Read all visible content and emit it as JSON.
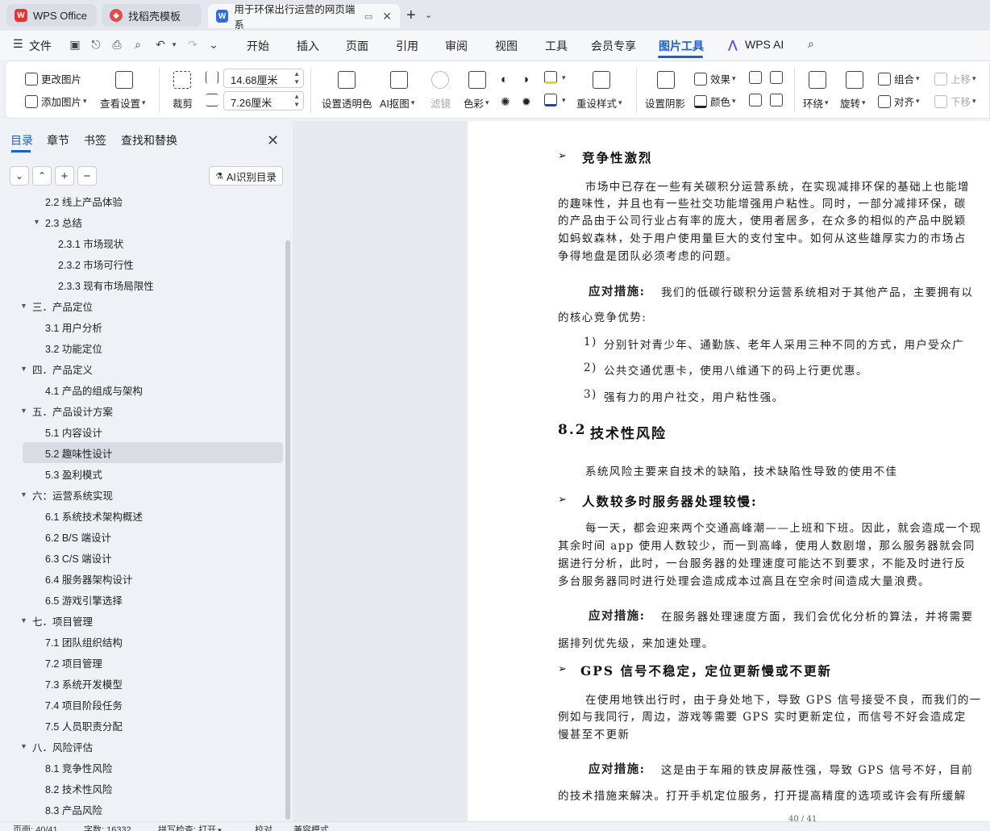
{
  "tabs": [
    {
      "label": "WPS Office",
      "icon": "wps-logo-icon"
    },
    {
      "label": "找稻壳模板",
      "icon": "docer-icon"
    },
    {
      "label": "用于环保出行运营的网页端系",
      "icon": "writer-doc-icon"
    }
  ],
  "menu": {
    "file": "文件",
    "items": [
      "开始",
      "插入",
      "页面",
      "引用",
      "审阅",
      "视图",
      "工具",
      "会员专享",
      "图片工具",
      "WPS AI"
    ]
  },
  "ribbon": {
    "change_image": "更改图片",
    "add_image": "添加图片",
    "view_settings": "查看设置",
    "crop": "裁剪",
    "width_value": "14.68厘米",
    "height_value": "7.26厘米",
    "set_transparent": "设置透明色",
    "ai_cutout": "AI抠图",
    "filter": "滤镜",
    "color": "色彩",
    "reset_style": "重设样式",
    "set_shadow": "设置阴影",
    "effects": "效果",
    "shade": "颜色",
    "wrap": "环绕",
    "rotate": "旋转",
    "group": "组合",
    "align": "对齐",
    "bring_forward": "上移",
    "send_backward": "下移"
  },
  "nav": {
    "tabs": [
      "目录",
      "章节",
      "书签",
      "查找和替换"
    ],
    "ai_toc": "AI识别目录",
    "toc": [
      {
        "label": "2.2  线上产品体验",
        "level": 2,
        "expand": ""
      },
      {
        "label": "2.3  总结",
        "level": 2,
        "expand": "▼"
      },
      {
        "label": "2.3.1  市场现状",
        "level": 3,
        "expand": ""
      },
      {
        "label": "2.3.2  市场可行性",
        "level": 3,
        "expand": ""
      },
      {
        "label": "2.3.3  现有市场局限性",
        "level": 3,
        "expand": ""
      },
      {
        "label": "三．产品定位",
        "level": 1,
        "expand": "▼"
      },
      {
        "label": "3.1  用户分析",
        "level": 2,
        "expand": ""
      },
      {
        "label": "3.2  功能定位",
        "level": 2,
        "expand": ""
      },
      {
        "label": "四．产品定义",
        "level": 1,
        "expand": "▼"
      },
      {
        "label": "4.1  产品的组成与架构",
        "level": 2,
        "expand": ""
      },
      {
        "label": "五．产品设计方案",
        "level": 1,
        "expand": "▼"
      },
      {
        "label": "5.1 内容设计",
        "level": 2,
        "expand": ""
      },
      {
        "label": "5.2  趣味性设计",
        "level": 2,
        "expand": "",
        "selected": true
      },
      {
        "label": "5.3  盈利模式",
        "level": 2,
        "expand": ""
      },
      {
        "label": "六：运营系统实现",
        "level": 1,
        "expand": "▼"
      },
      {
        "label": "6.1  系统技术架构概述",
        "level": 2,
        "expand": ""
      },
      {
        "label": "6.2 B/S 端设计",
        "level": 2,
        "expand": ""
      },
      {
        "label": "6.3 C/S 端设计",
        "level": 2,
        "expand": ""
      },
      {
        "label": "6.4 服务器架构设计",
        "level": 2,
        "expand": ""
      },
      {
        "label": "6.5 游戏引擎选择",
        "level": 2,
        "expand": ""
      },
      {
        "label": "七．项目管理",
        "level": 1,
        "expand": "▼"
      },
      {
        "label": "7.1  团队组织结构",
        "level": 2,
        "expand": ""
      },
      {
        "label": "7.2  项目管理",
        "level": 2,
        "expand": ""
      },
      {
        "label": "7.3  系统开发模型",
        "level": 2,
        "expand": ""
      },
      {
        "label": "7.4  项目阶段任务",
        "level": 2,
        "expand": ""
      },
      {
        "label": "7.5  人员职责分配",
        "level": 2,
        "expand": ""
      },
      {
        "label": "八．风险评估",
        "level": 1,
        "expand": "▼"
      },
      {
        "label": "8.1  竞争性风险",
        "level": 2,
        "expand": ""
      },
      {
        "label": "8.2  技术性风险",
        "level": 2,
        "expand": ""
      },
      {
        "label": "8.3  产品风险",
        "level": 2,
        "expand": ""
      }
    ]
  },
  "doc": {
    "h_competitive": "竞争性激烈",
    "p1_l1": "市场中已存在一些有关碳积分运营系统，在实现减排环保的基础上也能增",
    "p1_l2": "的趣味性，并且也有一些社交功能增强用户粘性。同时，一部分减排环保，碳",
    "p1_l3": "的产品由于公司行业占有率的庞大，使用者居多，在众多的相似的产品中脱颖",
    "p1_l4": "如蚂蚁森林，处于用户使用量巨大的支付宝中。如何从这些雄厚实力的市场占",
    "p1_l5": "争得地盘是团队必须考虑的问题。",
    "m1_label": "应对措施:",
    "m1_text": "我们的低碳行碳积分运营系统相对于其他产品，主要拥有以",
    "m1_l2": "的核心竞争优势:",
    "list": [
      {
        "n": "1)",
        "t": "分别针对青少年、通勤族、老年人采用三种不同的方式，用户受众广"
      },
      {
        "n": "2)",
        "t": "公共交通优惠卡，使用八维通下的码上行更优惠。"
      },
      {
        "n": "3)",
        "t": "强有力的用户社交，用户粘性强。"
      }
    ],
    "section_num": "8.2",
    "section_title": "技术性风险",
    "p2": "系统风险主要来自技术的缺陷，技术缺陷性导致的使用不佳",
    "h_server": "人数较多时服务器处理较慢:",
    "p3_l1": "每一天，都会迎来两个交通高峰潮——上班和下班。因此，就会造成一个现",
    "p3_l2": "其余时间 app 使用人数较少，而一到高峰，使用人数剧增，那么服务器就会同",
    "p3_l3": "据进行分析，此时，一台服务器的处理速度可能达不到要求，不能及时进行反",
    "p3_l4": "多台服务器同时进行处理会造成成本过高且在空余时间造成大量浪费。",
    "m2_label": "应对措施:",
    "m2_text": "在服务器处理速度方面，我们会优化分析的算法，并将需要",
    "m2_l2": "据排列优先级，来加速处理。",
    "h_gps": "GPS 信号不稳定，定位更新慢或不更新",
    "p4_l1": "在使用地铁出行时，由于身处地下，导致 GPS 信号接受不良，而我们的一",
    "p4_l2": "例如与我同行，周边，游戏等需要 GPS 实时更新定位，而信号不好会造成定",
    "p4_l3": "慢甚至不更新",
    "m3_label": "应对措施:",
    "m3_text": "这是由于车厢的铁皮屏蔽性强，导致 GPS 信号不好，目前",
    "m3_l2": "的技术措施来解决。打开手机定位服务，打开提高精度的选项或许会有所缓解",
    "page_footer": "40 / 41"
  },
  "status": {
    "page": "页面: 40/41",
    "words": "字数: 16332",
    "spell": "拼写检查: 打开",
    "proof": "校对",
    "compat": "兼容模式"
  },
  "colors": {
    "accent": "#1a5fd9",
    "selected_row": "#d9dde3"
  }
}
